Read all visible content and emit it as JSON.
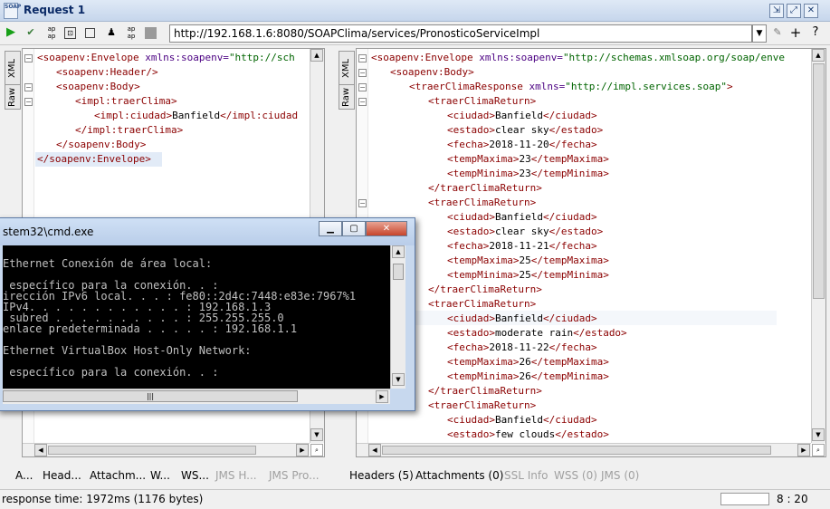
{
  "window": {
    "logo": "SOAP",
    "title": "Request 1"
  },
  "toolbar": {
    "icons": [
      "play-icon",
      "add-assertion-icon",
      "attachment-icon",
      "wsa-icon",
      "stop-icon",
      "user-icon",
      "wsrm-icon",
      "cancel-icon"
    ],
    "url": "http://192.168.1.6:8080/SOAPClima/services/PronosticoServiceImpl"
  },
  "request": {
    "side_tabs": [
      "XML",
      "Raw"
    ],
    "lines": [
      {
        "parts": [
          [
            "tag",
            "<soapenv:Envelope "
          ],
          [
            "attr",
            "xmlns:soapenv="
          ],
          [
            "val",
            "\"http://sch"
          ]
        ]
      },
      {
        "parts": [
          [
            "tag",
            "<soapenv:Header/>"
          ]
        ]
      },
      {
        "parts": [
          [
            "tag",
            "<soapenv:Body>"
          ]
        ]
      },
      {
        "parts": [
          [
            "tag",
            "<impl:traerClima>"
          ]
        ]
      },
      {
        "parts": [
          [
            "tag",
            "<impl:ciudad>"
          ],
          [
            "txt",
            "Banfield"
          ],
          [
            "tag",
            "</impl:ciudad"
          ]
        ]
      },
      {
        "parts": [
          [
            "tag",
            "</impl:traerClima>"
          ]
        ]
      },
      {
        "parts": [
          [
            "tag",
            "</soapenv:Body>"
          ]
        ]
      },
      {
        "parts": [
          [
            "tag",
            "</soapenv:Envelope>"
          ]
        ]
      }
    ],
    "tabs": [
      "A...",
      "Head...",
      "Attachm...",
      "W...",
      "WS...",
      "JMS H...",
      "JMS Pro..."
    ]
  },
  "response": {
    "side_tabs": [
      "XML",
      "Raw"
    ],
    "lines": [
      {
        "parts": [
          [
            "tag",
            "<soapenv:Envelope "
          ],
          [
            "attr",
            "xmlns:soapenv="
          ],
          [
            "val",
            "\"http://schemas.xmlsoap.org/soap/enve"
          ]
        ]
      },
      {
        "parts": [
          [
            "tag",
            "<soapenv:Body>"
          ]
        ]
      },
      {
        "parts": [
          [
            "tag",
            "<traerClimaResponse "
          ],
          [
            "attr",
            "xmlns="
          ],
          [
            "val",
            "\"http://impl.services.soap\""
          ],
          [
            "tag",
            ">"
          ]
        ]
      },
      {
        "parts": [
          [
            "tag",
            "<traerClimaReturn>"
          ]
        ]
      },
      {
        "parts": [
          [
            "tag",
            "<ciudad>"
          ],
          [
            "txt",
            "Banfield"
          ],
          [
            "tag",
            "</ciudad>"
          ]
        ]
      },
      {
        "parts": [
          [
            "tag",
            "<estado>"
          ],
          [
            "txt",
            "clear sky"
          ],
          [
            "tag",
            "</estado>"
          ]
        ]
      },
      {
        "parts": [
          [
            "tag",
            "<fecha>"
          ],
          [
            "txt",
            "2018-11-20"
          ],
          [
            "tag",
            "</fecha>"
          ]
        ]
      },
      {
        "parts": [
          [
            "tag",
            "<tempMaxima>"
          ],
          [
            "txt",
            "23"
          ],
          [
            "tag",
            "</tempMaxima>"
          ]
        ]
      },
      {
        "parts": [
          [
            "tag",
            "<tempMinima>"
          ],
          [
            "txt",
            "23"
          ],
          [
            "tag",
            "</tempMinima>"
          ]
        ]
      },
      {
        "parts": [
          [
            "tag",
            "</traerClimaReturn>"
          ]
        ]
      },
      {
        "parts": [
          [
            "tag",
            "<traerClimaReturn>"
          ]
        ]
      },
      {
        "parts": [
          [
            "tag",
            "<ciudad>"
          ],
          [
            "txt",
            "Banfield"
          ],
          [
            "tag",
            "</ciudad>"
          ]
        ]
      },
      {
        "parts": [
          [
            "tag",
            "<estado>"
          ],
          [
            "txt",
            "clear sky"
          ],
          [
            "tag",
            "</estado>"
          ]
        ]
      },
      {
        "parts": [
          [
            "tag",
            "<fecha>"
          ],
          [
            "txt",
            "2018-11-21"
          ],
          [
            "tag",
            "</fecha>"
          ]
        ]
      },
      {
        "parts": [
          [
            "tag",
            "<tempMaxima>"
          ],
          [
            "txt",
            "25"
          ],
          [
            "tag",
            "</tempMaxima>"
          ]
        ]
      },
      {
        "parts": [
          [
            "tag",
            "<tempMinima>"
          ],
          [
            "txt",
            "25"
          ],
          [
            "tag",
            "</tempMinima>"
          ]
        ]
      },
      {
        "parts": [
          [
            "tag",
            "</traerClimaReturn>"
          ]
        ]
      },
      {
        "parts": [
          [
            "tag",
            "<traerClimaReturn>"
          ]
        ]
      },
      {
        "parts": [
          [
            "tag",
            "<ciudad>"
          ],
          [
            "txt",
            "Banfield"
          ],
          [
            "tag",
            "</ciudad>"
          ]
        ]
      },
      {
        "parts": [
          [
            "tag",
            "<estado>"
          ],
          [
            "txt",
            "moderate rain"
          ],
          [
            "tag",
            "</estado>"
          ]
        ]
      },
      {
        "parts": [
          [
            "tag",
            "<fecha>"
          ],
          [
            "txt",
            "2018-11-22"
          ],
          [
            "tag",
            "</fecha>"
          ]
        ]
      },
      {
        "parts": [
          [
            "tag",
            "<tempMaxima>"
          ],
          [
            "txt",
            "26"
          ],
          [
            "tag",
            "</tempMaxima>"
          ]
        ]
      },
      {
        "parts": [
          [
            "tag",
            "<tempMinima>"
          ],
          [
            "txt",
            "26"
          ],
          [
            "tag",
            "</tempMinima>"
          ]
        ]
      },
      {
        "parts": [
          [
            "tag",
            "</traerClimaReturn>"
          ]
        ]
      },
      {
        "parts": [
          [
            "tag",
            "<traerClimaReturn>"
          ]
        ]
      },
      {
        "parts": [
          [
            "tag",
            "<ciudad>"
          ],
          [
            "txt",
            "Banfield"
          ],
          [
            "tag",
            "</ciudad>"
          ]
        ]
      },
      {
        "parts": [
          [
            "tag",
            "<estado>"
          ],
          [
            "txt",
            "few clouds"
          ],
          [
            "tag",
            "</estado>"
          ]
        ]
      }
    ],
    "tabs": [
      {
        "label": "Headers (5)",
        "disabled": false
      },
      {
        "label": "Attachments (0)",
        "disabled": false
      },
      {
        "label": "SSL Info",
        "disabled": true
      },
      {
        "label": "WSS (0)",
        "disabled": true
      },
      {
        "label": "JMS (0)",
        "disabled": true
      }
    ]
  },
  "status": {
    "response_time": "response time: 1972ms (1176 bytes)",
    "cursor": "8 : 20"
  },
  "cmd": {
    "title": "stem32\\cmd.exe",
    "lines": [
      "",
      "Ethernet Conexión de área local:",
      "",
      " específico para la conexión. . :",
      "irección IPv6 local. . . : fe80::2d4c:7448:e83e:7967%1",
      "IPv4. . . . . . . . . . . . : 192.168.1.3",
      " subred . . . . . . . . . . : 255.255.255.0",
      "enlace predeterminada . . . . . : 192.168.1.1",
      "",
      "Ethernet VirtualBox Host-Only Network:",
      "",
      " específico para la conexión. . :"
    ]
  }
}
